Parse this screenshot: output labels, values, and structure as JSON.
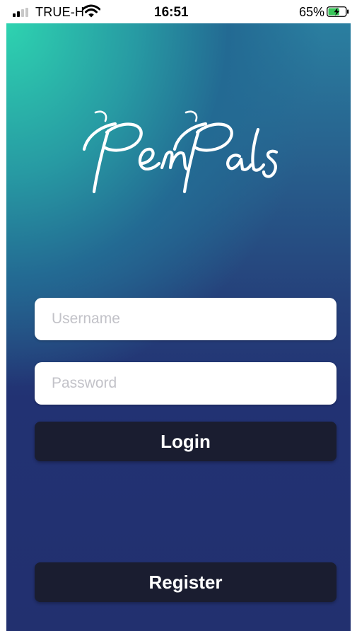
{
  "status_bar": {
    "carrier": "TRUE-H",
    "time": "16:51",
    "battery_percent": "65%",
    "battery_level": 0.65,
    "charging": true,
    "icons": [
      "signal-icon",
      "wifi-icon",
      "battery-charging-icon"
    ]
  },
  "app": {
    "logo_text": "PenPals",
    "colors": {
      "gradient_top": "#2ed3b0",
      "gradient_bottom": "#22306f",
      "button_bg": "#1a1d30",
      "button_text": "#ffffff",
      "field_bg": "#ffffff",
      "placeholder": "#c2c2c8"
    }
  },
  "form": {
    "username": {
      "placeholder": "Username",
      "value": ""
    },
    "password": {
      "placeholder": "Password",
      "value": ""
    },
    "login_label": "Login",
    "register_label": "Register"
  }
}
